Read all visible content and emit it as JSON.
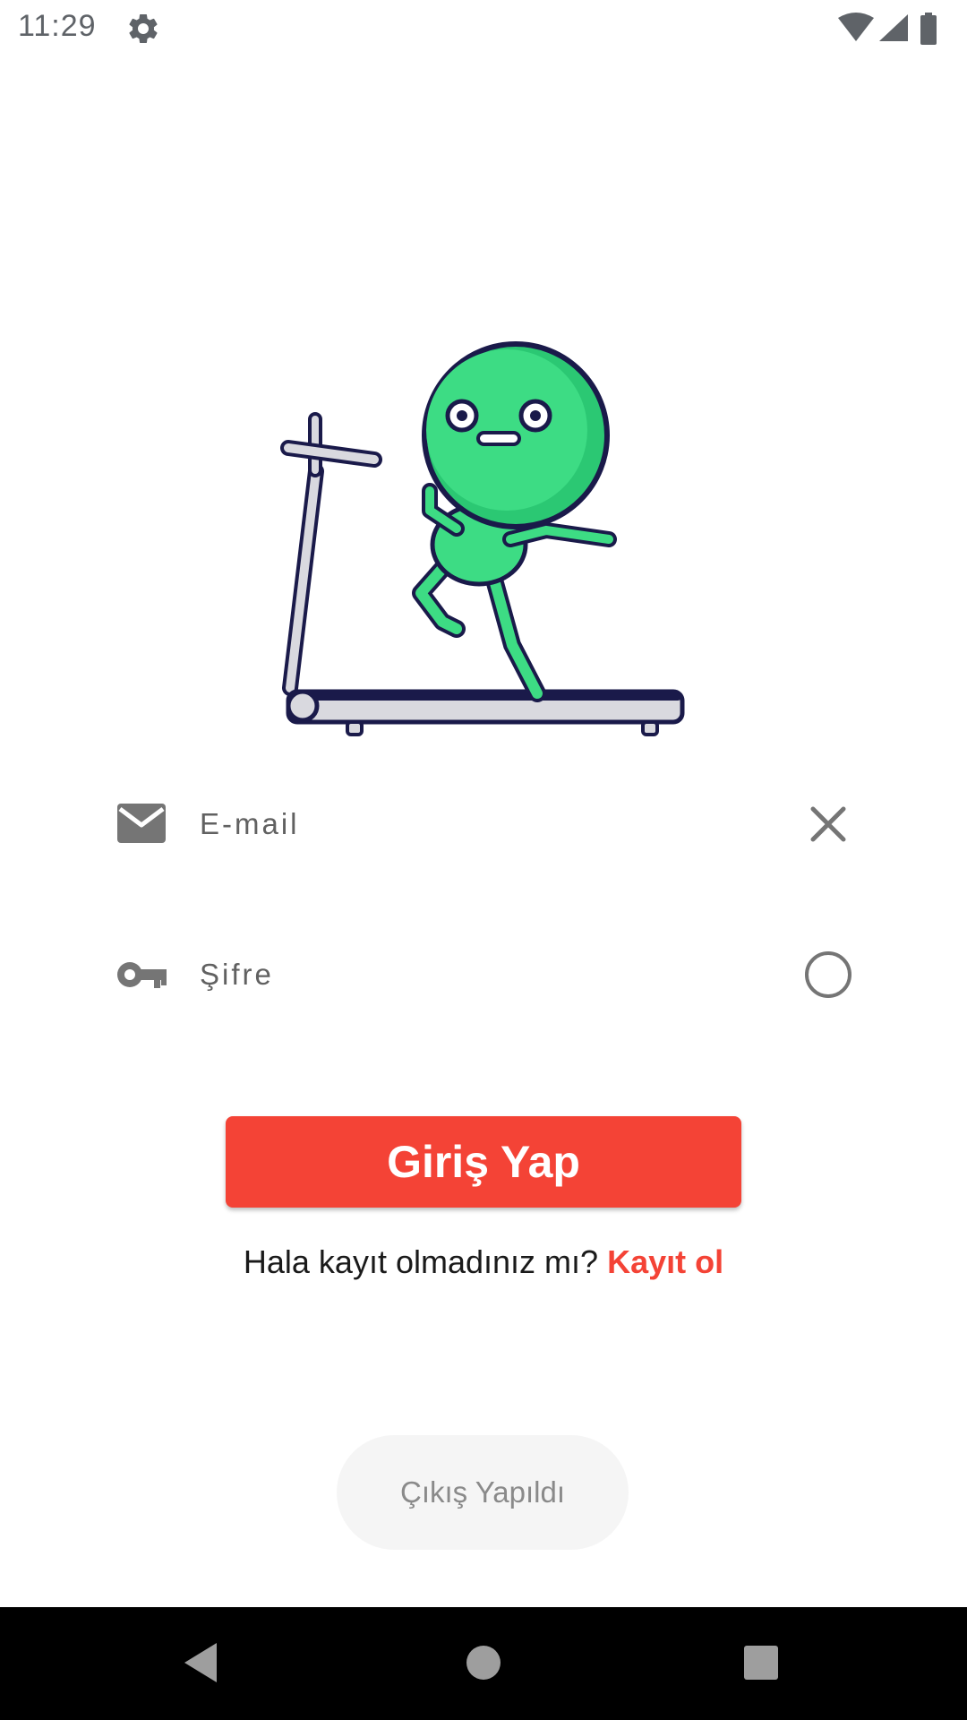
{
  "status_bar": {
    "time": "11:29",
    "icons": [
      "settings-gear-icon",
      "wifi-icon",
      "cellular-signal-icon",
      "battery-icon"
    ]
  },
  "illustration": {
    "subject": "green-character-running-on-treadmill",
    "colors": {
      "character": "#3ddc84",
      "outline": "#1a1a4a",
      "treadmill": "#d9d9df"
    }
  },
  "form": {
    "email": {
      "placeholder": "E-mail",
      "value": "",
      "icon": "envelope-icon",
      "action_icon": "clear-x-icon"
    },
    "password": {
      "placeholder": "Şifre",
      "value": "",
      "icon": "key-icon",
      "action_icon": "visibility-toggle-circle-icon"
    }
  },
  "login_button": {
    "label": "Giriş Yap"
  },
  "register": {
    "prompt": "Hala kayıt olmadınız mı?",
    "link": "Kayıt ol"
  },
  "toast": {
    "message": "Çıkış Yapıldı"
  },
  "colors": {
    "accent": "#f44336",
    "icon_gray": "#757575",
    "nav_bar": "#000000"
  },
  "nav_bar": {
    "buttons": [
      "back-icon",
      "home-icon",
      "recents-icon"
    ]
  }
}
